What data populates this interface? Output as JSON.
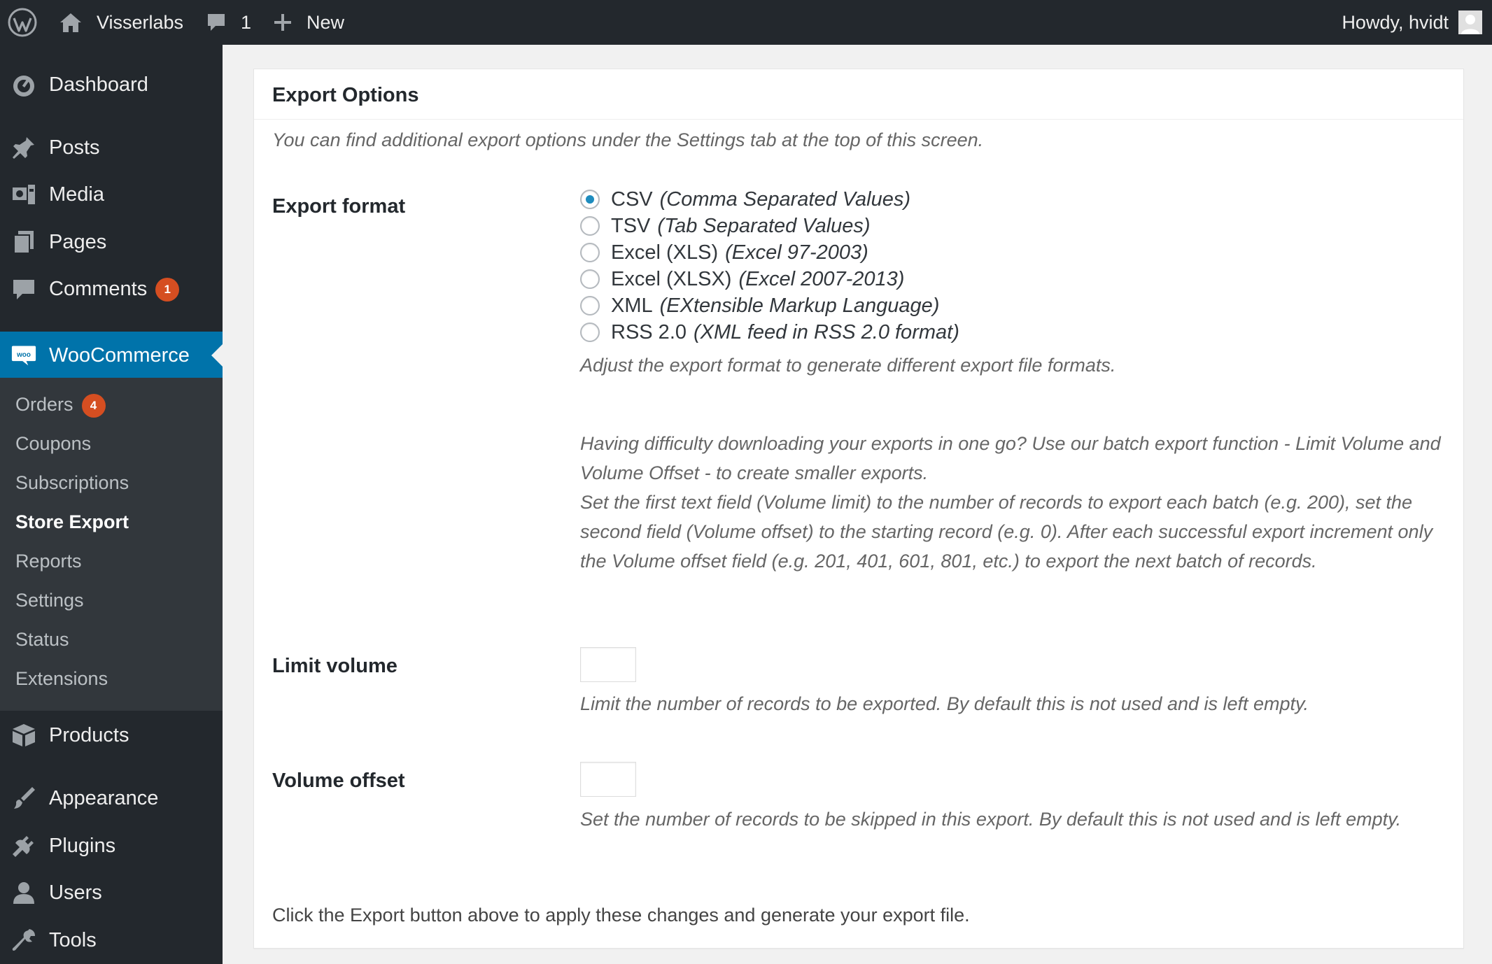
{
  "adminbar": {
    "site_name": "Visserlabs",
    "comments_count": "1",
    "new_label": "New",
    "howdy": "Howdy, hvidt"
  },
  "sidebar": {
    "items": [
      {
        "label": "Dashboard",
        "icon": "dashboard-icon"
      },
      {
        "label": "Posts",
        "icon": "pin-icon"
      },
      {
        "label": "Media",
        "icon": "media-icon"
      },
      {
        "label": "Pages",
        "icon": "pages-icon"
      },
      {
        "label": "Comments",
        "icon": "comment-icon",
        "badge": "1"
      },
      {
        "label": "WooCommerce",
        "icon": "woo-icon",
        "current": true
      },
      {
        "label": "Products",
        "icon": "box-icon"
      },
      {
        "label": "Appearance",
        "icon": "brush-icon"
      },
      {
        "label": "Plugins",
        "icon": "plug-icon"
      },
      {
        "label": "Users",
        "icon": "user-icon"
      },
      {
        "label": "Tools",
        "icon": "wrench-icon"
      }
    ],
    "submenu": [
      {
        "label": "Orders",
        "badge": "4"
      },
      {
        "label": "Coupons"
      },
      {
        "label": "Subscriptions"
      },
      {
        "label": "Store Export",
        "current": true
      },
      {
        "label": "Reports"
      },
      {
        "label": "Settings"
      },
      {
        "label": "Status"
      },
      {
        "label": "Extensions"
      }
    ]
  },
  "panel": {
    "title": "Export Options",
    "intro": "You can find additional export options under the Settings tab at the top of this screen.",
    "export_format": {
      "label": "Export format",
      "options": [
        {
          "name": "CSV",
          "note": "(Comma Separated Values)",
          "checked": true
        },
        {
          "name": "TSV",
          "note": "(Tab Separated Values)",
          "checked": false
        },
        {
          "name": "Excel (XLS)",
          "note": "(Excel 97-2003)",
          "checked": false
        },
        {
          "name": "Excel (XLSX)",
          "note": "(Excel 2007-2013)",
          "checked": false
        },
        {
          "name": "XML",
          "note": "(EXtensible Markup Language)",
          "checked": false
        },
        {
          "name": "RSS 2.0",
          "note": "(XML feed in RSS 2.0 format)",
          "checked": false
        }
      ],
      "help": "Adjust the export format to generate different export file formats."
    },
    "batch_help_1": "Having difficulty downloading your exports in one go? Use our batch export function - Limit Volume and Volume Offset - to create smaller exports.",
    "batch_help_2": "Set the first text field (Volume limit) to the number of records to export each batch (e.g. 200), set the second field (Volume offset) to the starting record (e.g. 0). After each successful export increment only the Volume offset field (e.g. 201, 401, 601, 801, etc.) to export the next batch of records.",
    "limit_volume": {
      "label": "Limit volume",
      "value": "",
      "help": "Limit the number of records to be exported. By default this is not used and is left empty."
    },
    "volume_offset": {
      "label": "Volume offset",
      "value": "",
      "help": "Set the number of records to be skipped in this export. By default this is not used and is left empty."
    },
    "footer": "Click the Export button above to apply these changes and generate your export file."
  }
}
